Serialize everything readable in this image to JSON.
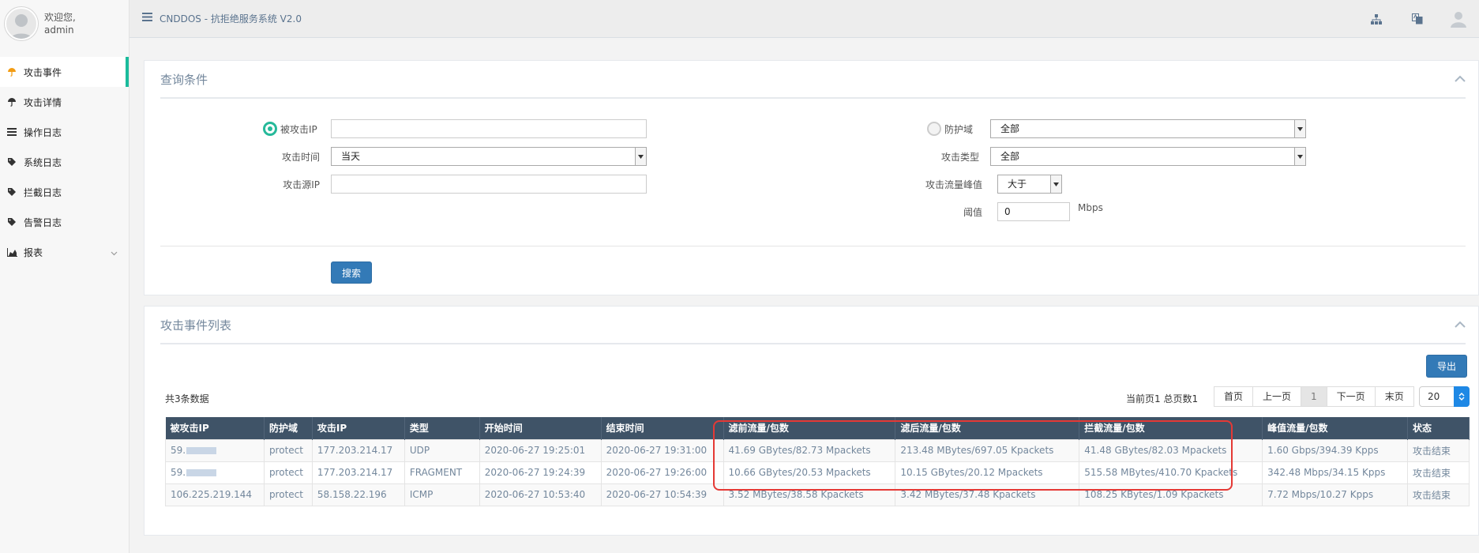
{
  "app": {
    "title": "CNDDOS - 抗拒绝服务系统 V2.0"
  },
  "user": {
    "welcome": "欢迎您,",
    "name": "admin"
  },
  "sidebar": {
    "items": [
      {
        "label": "攻击事件",
        "icon": "umbrella-icon"
      },
      {
        "label": "攻击详情",
        "icon": "umbrella-icon"
      },
      {
        "label": "操作日志",
        "icon": "list-icon"
      },
      {
        "label": "系统日志",
        "icon": "tag-icon"
      },
      {
        "label": "拦截日志",
        "icon": "tag-icon"
      },
      {
        "label": "告警日志",
        "icon": "tag-icon"
      },
      {
        "label": "报表",
        "icon": "area-chart-icon"
      }
    ]
  },
  "query": {
    "title": "查询条件",
    "target_ip_label": "被攻击IP",
    "target_ip_value": "",
    "attack_time_label": "攻击时间",
    "attack_time_value": "当天",
    "source_ip_label": "攻击源IP",
    "source_ip_value": "",
    "domain_label": "防护域",
    "domain_value": "全部",
    "attack_type_label": "攻击类型",
    "attack_type_value": "全部",
    "peak_label": "攻击流量峰值",
    "peak_value": "大于",
    "threshold_label": "阈值",
    "threshold_value": "0",
    "threshold_unit": "Mbps",
    "search_label": "搜索"
  },
  "list": {
    "title": "攻击事件列表",
    "export_label": "导出",
    "count_text": "共3条数据",
    "page_info": "当前页1 总页数1",
    "pager": [
      "首页",
      "上一页",
      "1",
      "下一页",
      "末页"
    ],
    "page_size": "20",
    "columns": [
      "被攻击IP",
      "防护域",
      "攻击IP",
      "类型",
      "开始时间",
      "结束时间",
      "滤前流量/包数",
      "滤后流量/包数",
      "拦截流量/包数",
      "峰值流量/包数",
      "状态"
    ],
    "rows": [
      [
        "59.",
        "protect",
        "177.203.214.17",
        "UDP",
        "2020-06-27 19:25:01",
        "2020-06-27 19:31:00",
        "41.69 GBytes/82.73 Mpackets",
        "213.48 MBytes/697.05 Kpackets",
        "41.48 GBytes/82.03 Mpackets",
        "1.60 Gbps/394.39 Kpps",
        "攻击结束"
      ],
      [
        "59.",
        "protect",
        "177.203.214.17",
        "FRAGMENT",
        "2020-06-27 19:24:39",
        "2020-06-27 19:26:00",
        "10.66 GBytes/20.53 Mpackets",
        "10.15 GBytes/20.12 Mpackets",
        "515.58 MBytes/410.70 Kpackets",
        "342.48 Mbps/34.15 Kpps",
        "攻击结束"
      ],
      [
        "106.225.219.144",
        "protect",
        "58.158.22.196",
        "ICMP",
        "2020-06-27 10:53:40",
        "2020-06-27 10:54:39",
        "3.52 MBytes/38.58 Kpackets",
        "3.42 MBytes/37.48 Kpackets",
        "108.25 KBytes/1.09 Kpackets",
        "7.72 Mbps/10.27 Kpps",
        "攻击结束"
      ]
    ]
  },
  "colors": {
    "accent": "#1abb9c",
    "header_bg": "#3f5367",
    "primary": "#337ab7",
    "highlight": "#e53935"
  }
}
